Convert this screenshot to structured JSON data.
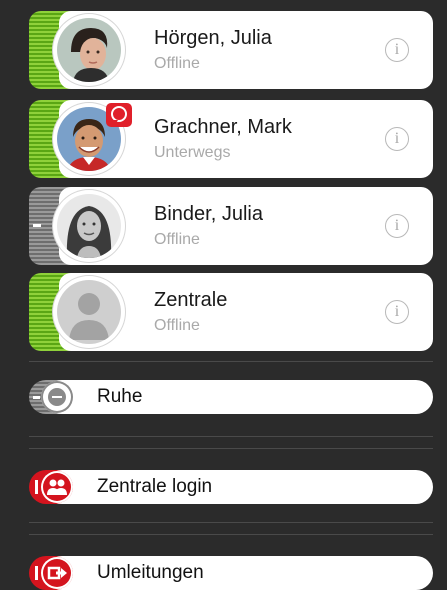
{
  "contacts": [
    {
      "name": "Hörgen, Julia",
      "status": "Offline",
      "presence": "green",
      "avatar": "photo-woman-short-hair"
    },
    {
      "name": "Grachner, Mark",
      "status": "Unterwegs",
      "presence": "green",
      "avatar": "photo-man-smiling",
      "badge": "chat-bubble-icon"
    },
    {
      "name": "Binder, Julia",
      "status": "Offline",
      "presence": "gray",
      "avatar": "photo-woman-long-hair"
    },
    {
      "name": "Zentrale",
      "status": "Offline",
      "presence": "green",
      "avatar": "placeholder-person"
    }
  ],
  "info_glyph": "i",
  "actions": [
    {
      "label": "Ruhe",
      "state": "off",
      "icon": "do-not-disturb-icon"
    },
    {
      "label": "Zentrale login",
      "state": "on",
      "icon": "group-icon"
    },
    {
      "label": "Umleitungen",
      "state": "on",
      "icon": "forward-icon"
    }
  ],
  "colors": {
    "background": "#2b2b2b",
    "presence_green": "#6bbd1f",
    "presence_gray": "#808080",
    "active_red": "#d4141e",
    "status_text": "#a9a9a9"
  }
}
